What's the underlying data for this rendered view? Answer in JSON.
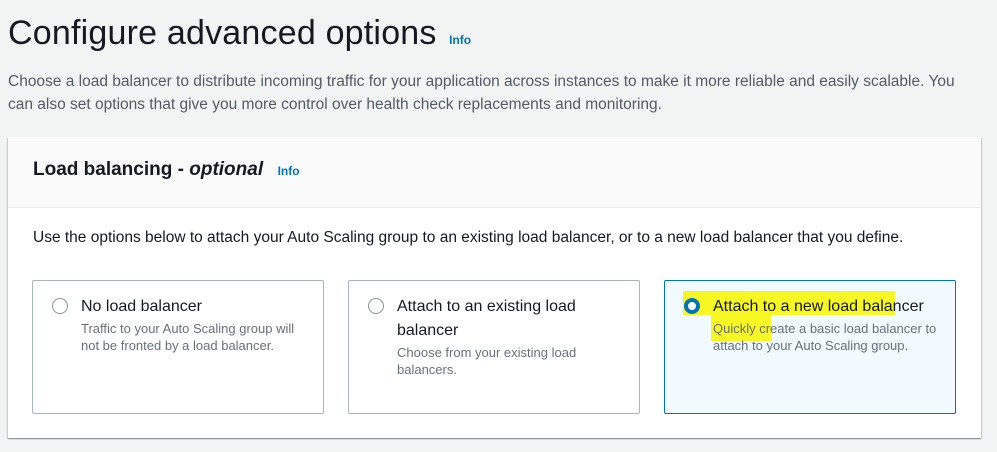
{
  "page": {
    "title": "Configure advanced options",
    "info_label": "Info",
    "description": "Choose a load balancer to distribute incoming traffic for your application across instances to make it more reliable and easily scalable. You can also set options that give you more control over health check replacements and monitoring."
  },
  "load_balancing": {
    "title": "Load balancing - ",
    "title_optional": "optional",
    "info_label": "Info",
    "description": "Use the options below to attach your Auto Scaling group to an existing load balancer, or to a new load balancer that you define.",
    "options": [
      {
        "label": "No load balancer",
        "description": "Traffic to your Auto Scaling group will not be fronted by a load balancer.",
        "selected": false
      },
      {
        "label": "Attach to an existing load balancer",
        "description": "Choose from your existing load balancers.",
        "selected": false
      },
      {
        "label": "Attach to a new load balancer",
        "description": "Quickly create a basic load balancer to attach to your Auto Scaling group.",
        "selected": true
      }
    ]
  },
  "colors": {
    "accent": "#0073bb",
    "highlight": "#f7f724"
  }
}
